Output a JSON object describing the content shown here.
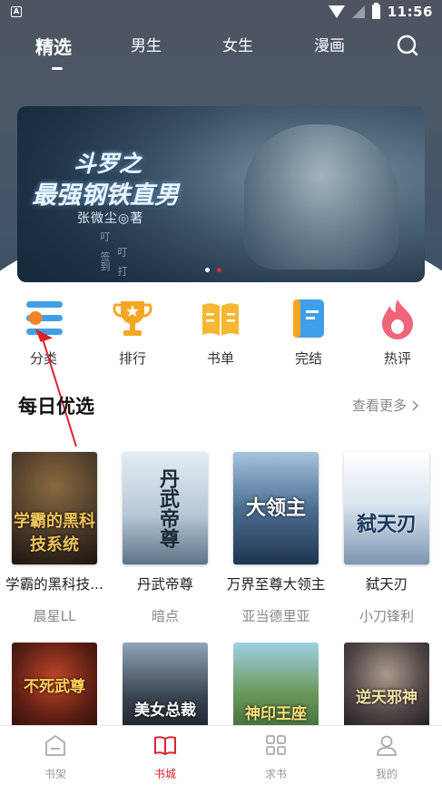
{
  "status_bar": {
    "time": "11:56",
    "badge_letter": "A"
  },
  "top_nav": {
    "tabs": [
      {
        "label": "精选",
        "active": true
      },
      {
        "label": "男生",
        "active": false
      },
      {
        "label": "女生",
        "active": false
      },
      {
        "label": "漫画",
        "active": false
      }
    ],
    "search_icon": "search-icon"
  },
  "banner": {
    "title_line1": "斗罗之",
    "title_line2": "最强钢铁直男",
    "author": "张微尘◎著",
    "vertical_text": [
      "叮",
      "叮",
      "签到",
      "打"
    ],
    "page_count": 2,
    "active_page": 2
  },
  "categories": [
    {
      "label": "分类",
      "icon": "list-icon"
    },
    {
      "label": "排行",
      "icon": "trophy-icon"
    },
    {
      "label": "书单",
      "icon": "open-book-icon"
    },
    {
      "label": "完结",
      "icon": "book-icon"
    },
    {
      "label": "热评",
      "icon": "flame-icon"
    }
  ],
  "section": {
    "title": "每日优选",
    "more_label": "查看更多"
  },
  "books_row1": [
    {
      "title": "学霸的黑科技...",
      "author": "晨星LL",
      "cover_text": "学霸的黑科技系统",
      "cover_color": "#4a3a2a"
    },
    {
      "title": "丹武帝尊",
      "author": "暗点",
      "cover_text": "丹武帝尊",
      "cover_color": "#c8d4e0"
    },
    {
      "title": "万界至尊大领主",
      "author": "亚当德里亚",
      "cover_text": "大领主",
      "cover_color": "#2e4a6e"
    },
    {
      "title": "弑天刃",
      "author": "小刀锋利",
      "cover_text": "弑天刃",
      "cover_color": "#e6eef5"
    }
  ],
  "books_row2": [
    {
      "cover_text": "不死武尊",
      "cover_color": "#5a1e14"
    },
    {
      "cover_text": "美女总裁",
      "cover_color": "#3a4450"
    },
    {
      "cover_text": "神印王座",
      "cover_color": "#3f6a3a"
    },
    {
      "cover_text": "逆天邪神",
      "cover_color": "#2c2628"
    }
  ],
  "bottom_nav": [
    {
      "label": "书架",
      "icon": "bookshelf-icon",
      "active": false
    },
    {
      "label": "书城",
      "icon": "bookstore-icon",
      "active": true
    },
    {
      "label": "求书",
      "icon": "grid-icon",
      "active": false
    },
    {
      "label": "我的",
      "icon": "user-icon",
      "active": false
    }
  ],
  "colors": {
    "accent": "#d8262f",
    "header_bg": "#4a5868",
    "category_blue": "#3fa0e8",
    "category_orange": "#f5a623"
  }
}
